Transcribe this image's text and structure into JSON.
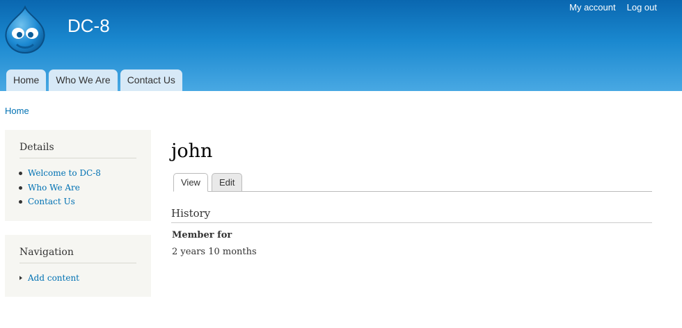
{
  "header": {
    "site_name": "DC-8",
    "secondary_menu": [
      "My account",
      "Log out"
    ],
    "main_menu": [
      "Home",
      "Who We Are",
      "Contact Us"
    ],
    "colors": {
      "header_top": "#0a67b0",
      "header_bottom": "#48a8e3",
      "tab": "#d7e9f7",
      "link": "#0071b3"
    }
  },
  "breadcrumb": "Home",
  "sidebar": {
    "details": {
      "title": "Details",
      "items": [
        "Welcome to DC-8",
        "Who We Are",
        "Contact Us"
      ]
    },
    "navigation": {
      "title": "Navigation",
      "items": [
        "Add content"
      ]
    }
  },
  "main": {
    "title": "john",
    "tabs": [
      "View",
      "Edit"
    ],
    "active_tab": "View",
    "section_title": "History",
    "field_label": "Member for",
    "field_value": "2 years 10 months"
  }
}
